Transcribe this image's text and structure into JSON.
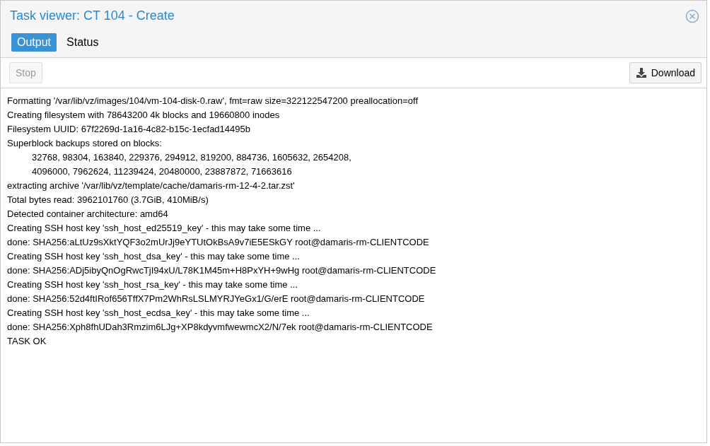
{
  "window": {
    "title": "Task viewer: CT 104 - Create"
  },
  "tabs": [
    {
      "label": "Output",
      "selected": true
    },
    {
      "label": "Status",
      "selected": false
    }
  ],
  "toolbar": {
    "stop": {
      "label": "Stop",
      "disabled": true
    },
    "download": {
      "label": "Download",
      "disabled": false
    }
  },
  "log": [
    {
      "text": "Formatting '/var/lib/vz/images/104/vm-104-disk-0.raw', fmt=raw size=322122547200 preallocation=off"
    },
    {
      "text": "Creating filesystem with 78643200 4k blocks and 19660800 inodes"
    },
    {
      "text": "Filesystem UUID: 67f2269d-1a16-4c82-b15c-1ecfad14495b"
    },
    {
      "text": "Superblock backups stored on blocks:",
      "children": [
        {
          "text": "32768, 98304, 163840, 229376, 294912, 819200, 884736, 1605632, 2654208,"
        },
        {
          "text": "4096000, 7962624, 11239424, 20480000, 23887872, 71663616"
        }
      ]
    },
    {
      "text": "extracting archive '/var/lib/vz/template/cache/damaris-rm-12-4-2.tar.zst'"
    },
    {
      "text": "Total bytes read: 3962101760 (3.7GiB, 410MiB/s)"
    },
    {
      "text": "Detected container architecture: amd64"
    },
    {
      "text": "Creating SSH host key 'ssh_host_ed25519_key' - this may take some time ..."
    },
    {
      "text": "done: SHA256:aLtUz9sXktYQF3o2mUrJj9eYTUtOkBsA9v7iE5ESkGY root@damaris-rm-CLIENTCODE"
    },
    {
      "text": "Creating SSH host key 'ssh_host_dsa_key' - this may take some time ..."
    },
    {
      "text": "done: SHA256:ADj5ibyQnOgRwcTjI94xU/L78K1M45m+H8PxYH+9wHg root@damaris-rm-CLIENTCODE"
    },
    {
      "text": "Creating SSH host key 'ssh_host_rsa_key' - this may take some time ..."
    },
    {
      "text": "done: SHA256:52d4ftIRof656TffX7Pm2WhRsLSLMYRJYeGx1/G/erE root@damaris-rm-CLIENTCODE"
    },
    {
      "text": "Creating SSH host key 'ssh_host_ecdsa_key' - this may take some time ..."
    },
    {
      "text": "done: SHA256:Xph8fhUDah3Rmzim6LJg+XP8kdyvmfwewmcX2/N/7ek root@damaris-rm-CLIENTCODE"
    },
    {
      "text": "TASK OK"
    }
  ]
}
